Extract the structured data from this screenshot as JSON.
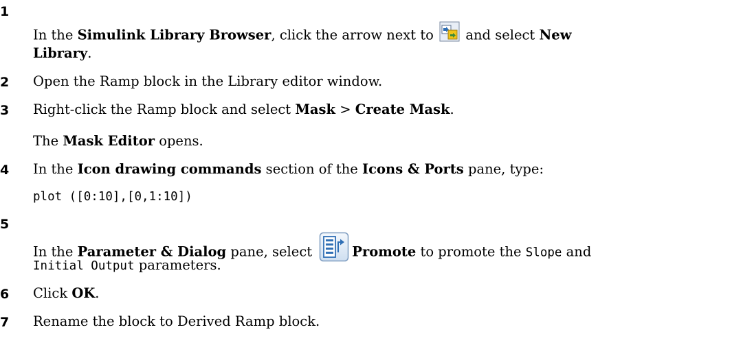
{
  "steps": [
    {
      "number": "1",
      "text_a": "In the ",
      "bold_a": "Simulink Library Browser",
      "text_b": ", click the arrow next to ",
      "icon": "new-library-icon",
      "text_c": " and select ",
      "bold_b": "New",
      "bold_c": "Library",
      "text_d": "."
    },
    {
      "number": "2",
      "text": "Open the Ramp block in the Library editor window."
    },
    {
      "number": "3",
      "text_a": "Right-click the Ramp block and select ",
      "bold_a": "Mask",
      "text_b": " > ",
      "bold_b": "Create Mask",
      "text_c": ".",
      "sub_bold": "Mask Editor",
      "sub_text": " opens.",
      "sub_prefix": "The "
    },
    {
      "number": "4",
      "text_a": "In the ",
      "bold_a": "Icon drawing commands",
      "text_b": " section of the ",
      "bold_b": "Icons & Ports",
      "text_c": " pane, type:",
      "code": "plot ([0:10],[0,1:10])"
    },
    {
      "number": "5",
      "text_a": "In the ",
      "bold_a": "Parameter & Dialog",
      "text_b": " pane, select ",
      "icon": "promote-icon",
      "bold_b": "Promote",
      "text_c": " to promote the ",
      "mono_a": "Slope",
      "text_d": " and",
      "mono_b": "Initial Output",
      "text_e": " parameters."
    },
    {
      "number": "6",
      "text_a": "Click ",
      "bold_a": "OK",
      "text_b": "."
    },
    {
      "number": "7",
      "text": "Rename the block to Derived Ramp block."
    }
  ],
  "colors": {
    "text": "#000000",
    "icon_blue": "#2f6fb5",
    "icon_yellow": "#f0c419"
  }
}
